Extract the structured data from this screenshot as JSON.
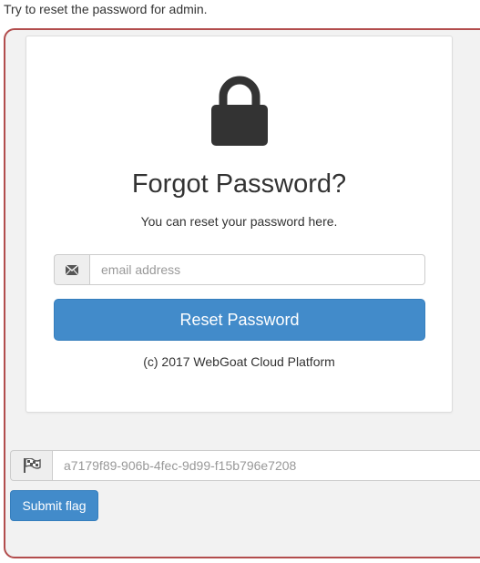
{
  "instruction": "Try to reset the password for admin.",
  "reset_form": {
    "title": "Forgot Password?",
    "subtitle": "You can reset your password here.",
    "email_icon": "envelope-icon",
    "email_placeholder": "email address",
    "email_value": "",
    "button_label": "Reset Password",
    "copyright": "(c) 2017 WebGoat Cloud Platform",
    "lock_icon": "lock-icon"
  },
  "flag": {
    "icon": "flag-checkered-icon",
    "placeholder": "a7179f89-906b-4fec-9d99-f15b796e7208",
    "value": "",
    "submit_label": "Submit flag"
  },
  "colors": {
    "primary": "#428bca",
    "container_border": "#b24d4d",
    "container_bg": "#f2f2f2"
  }
}
